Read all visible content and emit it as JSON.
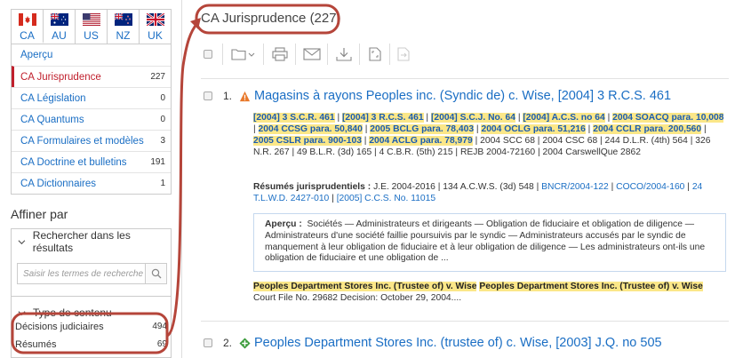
{
  "countries": [
    {
      "code": "CA",
      "flag": "canada-flag-icon"
    },
    {
      "code": "AU",
      "flag": "australia-flag-icon"
    },
    {
      "code": "US",
      "flag": "usa-flag-icon"
    },
    {
      "code": "NZ",
      "flag": "new-zealand-flag-icon"
    },
    {
      "code": "UK",
      "flag": "uk-flag-icon"
    }
  ],
  "sources": [
    {
      "label": "Aperçu",
      "count": ""
    },
    {
      "label": "CA Jurisprudence",
      "count": "227"
    },
    {
      "label": "CA Législation",
      "count": "0"
    },
    {
      "label": "CA Quantums",
      "count": "0"
    },
    {
      "label": "CA Formulaires et modèles",
      "count": "3"
    },
    {
      "label": "CA Doctrine et bulletins",
      "count": "191"
    },
    {
      "label": "CA Dictionnaires",
      "count": "1"
    }
  ],
  "refine": {
    "title": "Affiner par",
    "search_in_results": "Rechercher dans les résultats",
    "search_placeholder": "Saisir les termes de recherche",
    "content_type": "Type de contenu",
    "types": [
      {
        "label": "Décisions judiciaires",
        "count": "494"
      },
      {
        "label": "Résumés",
        "count": "69"
      }
    ]
  },
  "main": {
    "title": "CA Jurisprudence (227)"
  },
  "colors": {
    "accent_red": "#c0202d",
    "link_blue": "#1a6ec4",
    "highlight": "#fbe788",
    "annotation": "#b5453a"
  },
  "results": [
    {
      "num": "1.",
      "icon": "warning-triangle-icon",
      "title": "Magasins à rayons Peoples inc. (Syndic de) c. Wise, [2004] 3 R.C.S. 461",
      "cites_hl": [
        "[2004] 3 S.C.R. 461",
        "[2004] 3 R.C.S. 461",
        "[2004] S.C.J. No. 64",
        "[2004] A.C.S. no 64",
        "2004 SOACQ para. 10,008",
        "2004 CCSG para. 50,840",
        "2005 BCLG para. 78,403",
        "2004 OCLG para. 51,216",
        "2004 CCLR para. 200,560",
        "2005 CSLR para. 900-103",
        "2004 ACLG para. 78,979"
      ],
      "cites_rest": "2004 SCC 68 | 2004 CSC 68 | 244 D.L.R. (4th) 564 | 326 N.R. 267 | 49 B.L.R. (3d) 165 | 4 C.B.R. (5th) 215 | REJB 2004-72160 | 2004 CarswellQue 2862",
      "resumes_label": "Résumés jurisprudentiels :",
      "resumes_text": "J.E. 2004-2016 | 134 A.C.W.S. (3d) 548 |",
      "resumes_links": [
        "BNCR/2004-122",
        "COCO/2004-160",
        "24 T.L.W.D. 2427-010",
        "[2005] C.C.S. No. 11015"
      ],
      "summary_label": "Aperçu :",
      "summary_text": "Sociétés — Administrateurs et dirigeants — Obligation de fiduciaire et obligation de diligence — Administrateurs d'une société faillie poursuivis par le syndic — Administrateurs accusés par le syndic de manquement à leur obligation de fiduciaire et à leur obligation de diligence — Les administrateurs ont-ils une obligation de fiduciaire et une obligation de ...",
      "snippet_hl_1": "Peoples Department Stores Inc. (Trustee of) v. Wise",
      "snippet_hl_2": "Peoples Department Stores Inc. (Trustee of) v. Wise",
      "snippet_rest": "Court File No. 29682 Decision: October 29, 2004...."
    },
    {
      "num": "2.",
      "icon": "green-plus-diamond-icon",
      "title": "Peoples Department Stores Inc. (trustee of) c. Wise, [2003] J.Q. no 505"
    }
  ]
}
